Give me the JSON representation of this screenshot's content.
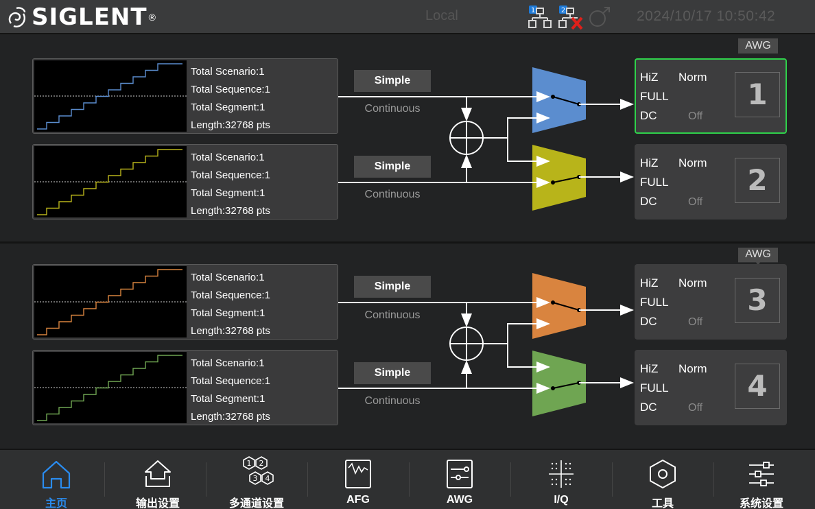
{
  "header": {
    "brand": "SIGLENT",
    "brand_mark": "®",
    "mode": "Local",
    "datetime": "2024/10/17  10:50:42",
    "net1_badge": "1",
    "net2_badge": "2"
  },
  "groups": [
    {
      "tag": "AWG"
    },
    {
      "tag": "AWG"
    }
  ],
  "channels": [
    {
      "scenario": "Total Scenario:1",
      "sequence": "Total Sequence:1",
      "segment": "Total Segment:1",
      "length": "Length:32768 pts",
      "mode": "Simple",
      "run": "Continuous",
      "load": "HiZ",
      "polarity": "Norm",
      "range": "FULL",
      "coupling": "DC",
      "state": "Off",
      "number": "1",
      "color": "#5b8dcf",
      "active": true
    },
    {
      "scenario": "Total Scenario:1",
      "sequence": "Total Sequence:1",
      "segment": "Total Segment:1",
      "length": "Length:32768 pts",
      "mode": "Simple",
      "run": "Continuous",
      "load": "HiZ",
      "polarity": "Norm",
      "range": "FULL",
      "coupling": "DC",
      "state": "Off",
      "number": "2",
      "color": "#b8b41a",
      "active": false
    },
    {
      "scenario": "Total Scenario:1",
      "sequence": "Total Sequence:1",
      "segment": "Total Segment:1",
      "length": "Length:32768 pts",
      "mode": "Simple",
      "run": "Continuous",
      "load": "HiZ",
      "polarity": "Norm",
      "range": "FULL",
      "coupling": "DC",
      "state": "Off",
      "number": "3",
      "color": "#d9843f",
      "active": false
    },
    {
      "scenario": "Total Scenario:1",
      "sequence": "Total Sequence:1",
      "segment": "Total Segment:1",
      "length": "Length:32768 pts",
      "mode": "Simple",
      "run": "Continuous",
      "load": "HiZ",
      "polarity": "Norm",
      "range": "FULL",
      "coupling": "DC",
      "state": "Off",
      "number": "4",
      "color": "#6fa552",
      "active": false
    }
  ],
  "nav": [
    {
      "label": "主页",
      "icon": "home-icon",
      "active": true
    },
    {
      "label": "输出设置",
      "icon": "output-icon",
      "active": false
    },
    {
      "label": "多通道设置",
      "icon": "multichannel-icon",
      "active": false
    },
    {
      "label": "AFG",
      "icon": "afg-icon",
      "active": false
    },
    {
      "label": "AWG",
      "icon": "awg-icon",
      "active": false
    },
    {
      "label": "I/Q",
      "icon": "iq-icon",
      "active": false
    },
    {
      "label": "工具",
      "icon": "tools-icon",
      "active": false
    },
    {
      "label": "系统设置",
      "icon": "settings-icon",
      "active": false
    }
  ],
  "colors": {
    "accent": "#2a8cf0",
    "active_border": "#2fd24b"
  }
}
